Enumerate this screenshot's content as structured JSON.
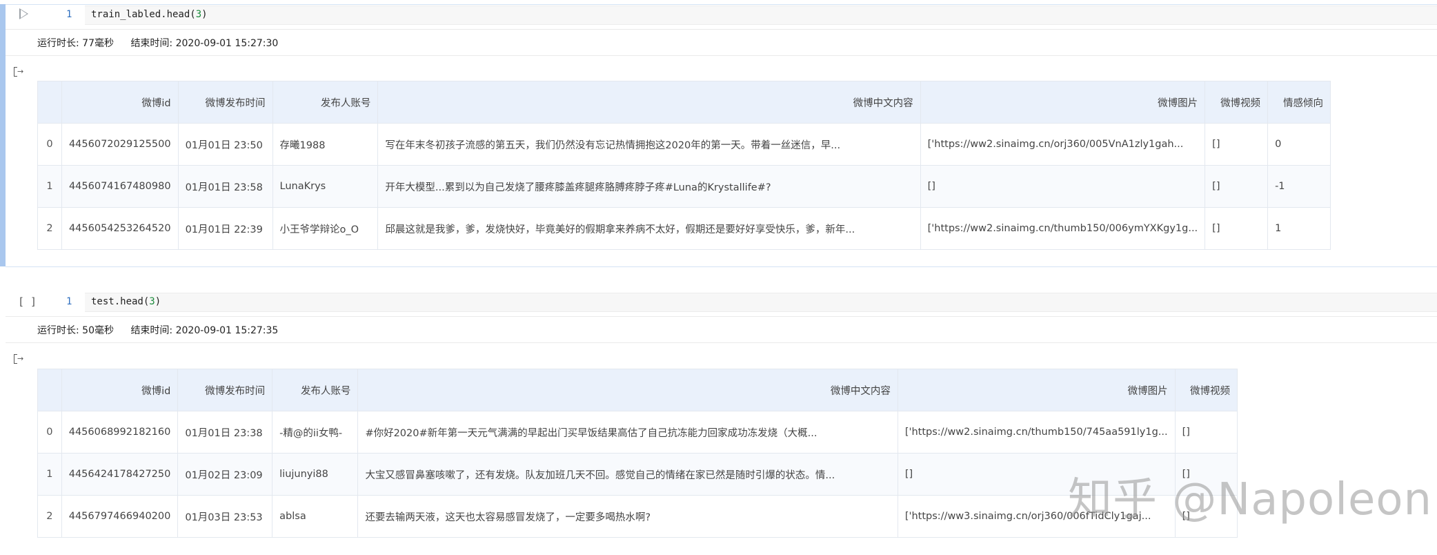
{
  "cell1": {
    "line_number": "1",
    "code_prefix": "train_labled.head(",
    "code_arg": "3",
    "code_suffix": ")",
    "exec_time": "运行时长: 77毫秒",
    "end_time": "结束时间: 2020-09-01 15:27:30",
    "table": {
      "headers": [
        "",
        "微博id",
        "微博发布时间",
        "发布人账号",
        "微博中文内容",
        "微博图片",
        "微博视频",
        "情感倾向"
      ],
      "rows": [
        [
          "0",
          "4456072029125500",
          "01月01日 23:50",
          "存曦1988",
          "写在年末冬初孩子流感的第五天，我们仍然没有忘记热情拥抱这2020年的第一天。带着一丝迷信，早...",
          "['https://ww2.sinaimg.cn/orj360/005VnA1zly1gah...",
          "[]",
          "0"
        ],
        [
          "1",
          "4456074167480980",
          "01月01日 23:58",
          "LunaKrys",
          "开年大模型...累到以为自己发烧了腰疼膝盖疼腿疼胳膊疼脖子疼#Luna的Krystallife#?",
          "[]",
          "[]",
          "-1"
        ],
        [
          "2",
          "4456054253264520",
          "01月01日 22:39",
          "小王爷学辩论o_O",
          "邱晨这就是我爹，爹，发烧快好，毕竟美好的假期拿来养病不太好，假期还是要好好享受快乐，爹，新年...",
          "['https://ww2.sinaimg.cn/thumb150/006ymYXKgy1g...",
          "[]",
          "1"
        ]
      ]
    }
  },
  "cell2": {
    "exec_count": "[ ]",
    "line_number": "1",
    "code_prefix": "test.head(",
    "code_arg": "3",
    "code_suffix": ")",
    "exec_time": "运行时长: 50毫秒",
    "end_time": "结束时间: 2020-09-01 15:27:35",
    "table": {
      "headers": [
        "",
        "微博id",
        "微博发布时间",
        "发布人账号",
        "微博中文内容",
        "微博图片",
        "微博视频"
      ],
      "rows": [
        [
          "0",
          "4456068992182160",
          "01月01日 23:38",
          "-精@的ii女鸭-",
          "#你好2020#新年第一天元气满满的早起出门买早饭结果高估了自己抗冻能力回家成功冻发烧（大概...",
          "['https://ww2.sinaimg.cn/thumb150/745aa591ly1g...",
          "[]"
        ],
        [
          "1",
          "4456424178427250",
          "01月02日 23:09",
          "liujunyi88",
          "大宝又感冒鼻塞咳嗽了，还有发烧。队友加班几天不回。感觉自己的情绪在家已然是随时引爆的状态。情...",
          "[]",
          "[]"
        ],
        [
          "2",
          "4456797466940200",
          "01月03日 23:53",
          "ablsa",
          "还要去输两天液，这天也太容易感冒发烧了，一定要多喝热水啊?",
          "['https://ww3.sinaimg.cn/orj360/006fTidCly1gaj...",
          "[]"
        ]
      ]
    }
  },
  "watermark": "知乎 @Napoleon"
}
